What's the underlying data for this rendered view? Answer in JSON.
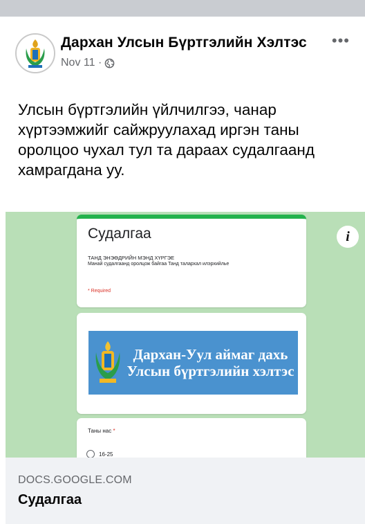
{
  "post": {
    "page_name": "Дархан Улсын Бүртгэлийн Хэлтэс",
    "date": "Nov 11 ·",
    "privacy_icon": "globe-icon",
    "more_icon": "more-options-icon",
    "more_label": "•••",
    "text": "Улсын бүртгэлийн үйлчилгээ, чанар хүртээмжийг сайжруулахад иргэн таны оролцоо чухал тул та дараах судалгаанд хамрагдана уу."
  },
  "preview": {
    "form_title": "Судалгаа",
    "form_greeting": "ТАНД ЭНЭӨДРИЙН МЭНД ХҮРГЭЕ",
    "form_description": "Манай судалгаанд оролцож байгаа Танд талархал илэрхийлье",
    "required_note": "* Required",
    "banner_text": "Дархан-Уул аймаг дахь Улсын бүртгэлийн хэлтэс",
    "question_label": "Таны нас",
    "question_required_mark": "*",
    "option_1": "16-25",
    "info_label": "i"
  },
  "link": {
    "domain": "DOCS.GOOGLE.COM",
    "title": "Судалгаа"
  },
  "colors": {
    "preview_bg": "#b9dfb7",
    "form_accent": "#23b24c",
    "banner_bg": "#4a92cf",
    "footer_bg": "#f0f2f5"
  }
}
